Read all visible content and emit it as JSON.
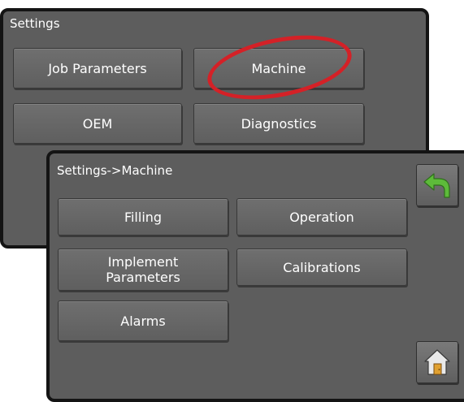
{
  "settings_panel": {
    "title": "Settings",
    "buttons": [
      {
        "label": "Job Parameters"
      },
      {
        "label": "Machine"
      },
      {
        "label": "OEM"
      },
      {
        "label": "Diagnostics"
      }
    ],
    "highlight": {
      "target": "Machine",
      "color": "#d42127"
    }
  },
  "machine_panel": {
    "title": "Settings->Machine",
    "buttons": [
      {
        "label": "Filling"
      },
      {
        "label": "Operation"
      },
      {
        "label": "Implement Parameters"
      },
      {
        "label": "Calibrations"
      },
      {
        "label": "Alarms"
      }
    ]
  },
  "side_buttons": {
    "back": {
      "icon": "back-arrow-icon",
      "color": "#5dbb3a"
    },
    "home": {
      "icon": "home-icon",
      "color": "#e9e9e9"
    }
  }
}
